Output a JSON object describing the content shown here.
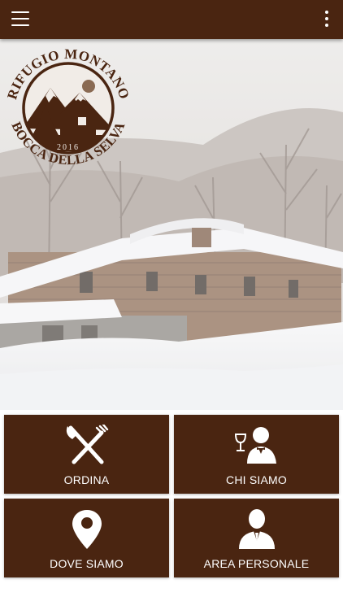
{
  "logo": {
    "name_top": "RIFUGIO MONTANO",
    "name_bottom": "BOCCA DELLA SELVA",
    "year": "2016"
  },
  "menu": [
    {
      "label": "ORDINA",
      "icon": "fork-knife-icon"
    },
    {
      "label": "CHI SIAMO",
      "icon": "waiter-icon"
    },
    {
      "label": "DOVE SIAMO",
      "icon": "map-pin-icon"
    },
    {
      "label": "AREA PERSONALE",
      "icon": "user-icon"
    }
  ],
  "colors": {
    "brand_brown": "#4a2511",
    "text_on_brand": "#ffffff"
  }
}
